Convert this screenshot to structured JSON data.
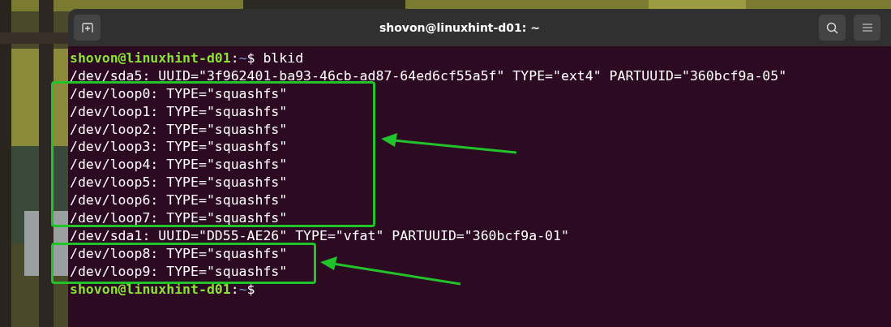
{
  "window": {
    "title": "shovon@linuxhint-d01: ~"
  },
  "lines": [
    {
      "kind": "prompt",
      "user_host": "shovon@linuxhint-d01",
      "separator": ":",
      "path": "~",
      "symbol": "$",
      "command": "blkid"
    },
    {
      "kind": "output",
      "text": "/dev/sda5: UUID=\"3f962401-ba93-46cb-ad87-64ed6cf55a5f\" TYPE=\"ext4\" PARTUUID=\"360bcf9a-05\""
    },
    {
      "kind": "output",
      "text": "/dev/loop0: TYPE=\"squashfs\""
    },
    {
      "kind": "output",
      "text": "/dev/loop1: TYPE=\"squashfs\""
    },
    {
      "kind": "output",
      "text": "/dev/loop2: TYPE=\"squashfs\""
    },
    {
      "kind": "output",
      "text": "/dev/loop3: TYPE=\"squashfs\""
    },
    {
      "kind": "output",
      "text": "/dev/loop4: TYPE=\"squashfs\""
    },
    {
      "kind": "output",
      "text": "/dev/loop5: TYPE=\"squashfs\""
    },
    {
      "kind": "output",
      "text": "/dev/loop6: TYPE=\"squashfs\""
    },
    {
      "kind": "output",
      "text": "/dev/loop7: TYPE=\"squashfs\""
    },
    {
      "kind": "output",
      "text": "/dev/sda1: UUID=\"DD55-AE26\" TYPE=\"vfat\" PARTUUID=\"360bcf9a-01\""
    },
    {
      "kind": "output",
      "text": "/dev/loop8: TYPE=\"squashfs\""
    },
    {
      "kind": "output",
      "text": "/dev/loop9: TYPE=\"squashfs\""
    },
    {
      "kind": "prompt",
      "user_host": "shovon@linuxhint-d01",
      "separator": ":",
      "path": "~",
      "symbol": "$"
    }
  ]
}
